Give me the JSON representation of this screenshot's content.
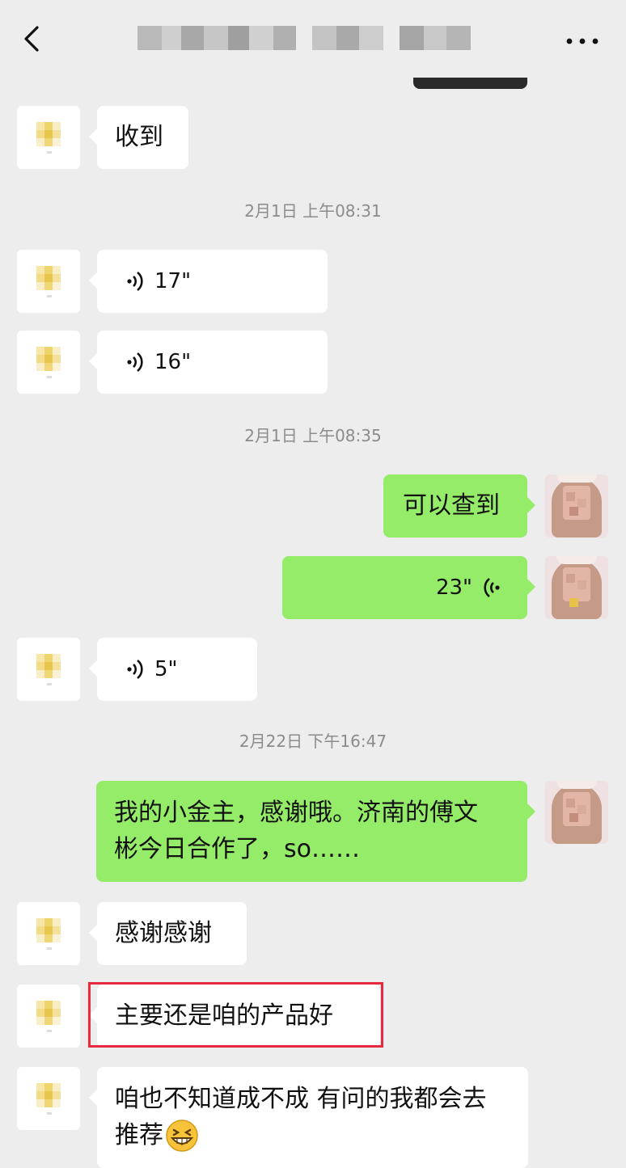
{
  "header": {
    "back_icon": "chevron-left-icon",
    "title_text": "",
    "more_icon": "more-dots-icon",
    "more_glyph": "•••"
  },
  "colors": {
    "background": "#ededed",
    "incoming_bubble": "#ffffff",
    "outgoing_bubble": "#95ec69",
    "timestamp": "#8c8c8c",
    "highlight": "#e8283f"
  },
  "timestamps": {
    "t1": "2月1日 上午08:31",
    "t2": "2月1日 上午08:35",
    "t3": "2月22日 下午16:47"
  },
  "messages": [
    {
      "id": "m1",
      "from": "contact",
      "type": "text",
      "text": "收到"
    },
    {
      "id": "m2",
      "from": "contact",
      "type": "voice",
      "duration": "17\""
    },
    {
      "id": "m3",
      "from": "contact",
      "type": "voice",
      "duration": "16\""
    },
    {
      "id": "m4",
      "from": "me",
      "type": "text",
      "text": "可以查到"
    },
    {
      "id": "m5",
      "from": "me",
      "type": "voice",
      "duration": "23\""
    },
    {
      "id": "m6",
      "from": "contact",
      "type": "voice",
      "duration": "5\""
    },
    {
      "id": "m7",
      "from": "me",
      "type": "text",
      "line1": "我的小金主，感谢哦。济南的傅文",
      "line2": "彬今日合作了，so……"
    },
    {
      "id": "m8",
      "from": "contact",
      "type": "text",
      "text": "感谢感谢"
    },
    {
      "id": "m9",
      "from": "contact",
      "type": "text",
      "text": "主要还是咱的产品好",
      "highlighted": true
    },
    {
      "id": "m10",
      "from": "contact",
      "type": "text",
      "line1": "咱也不知道成不成 有问的我都会去",
      "line2": "推荐",
      "emoji": "grin-emoji"
    }
  ]
}
